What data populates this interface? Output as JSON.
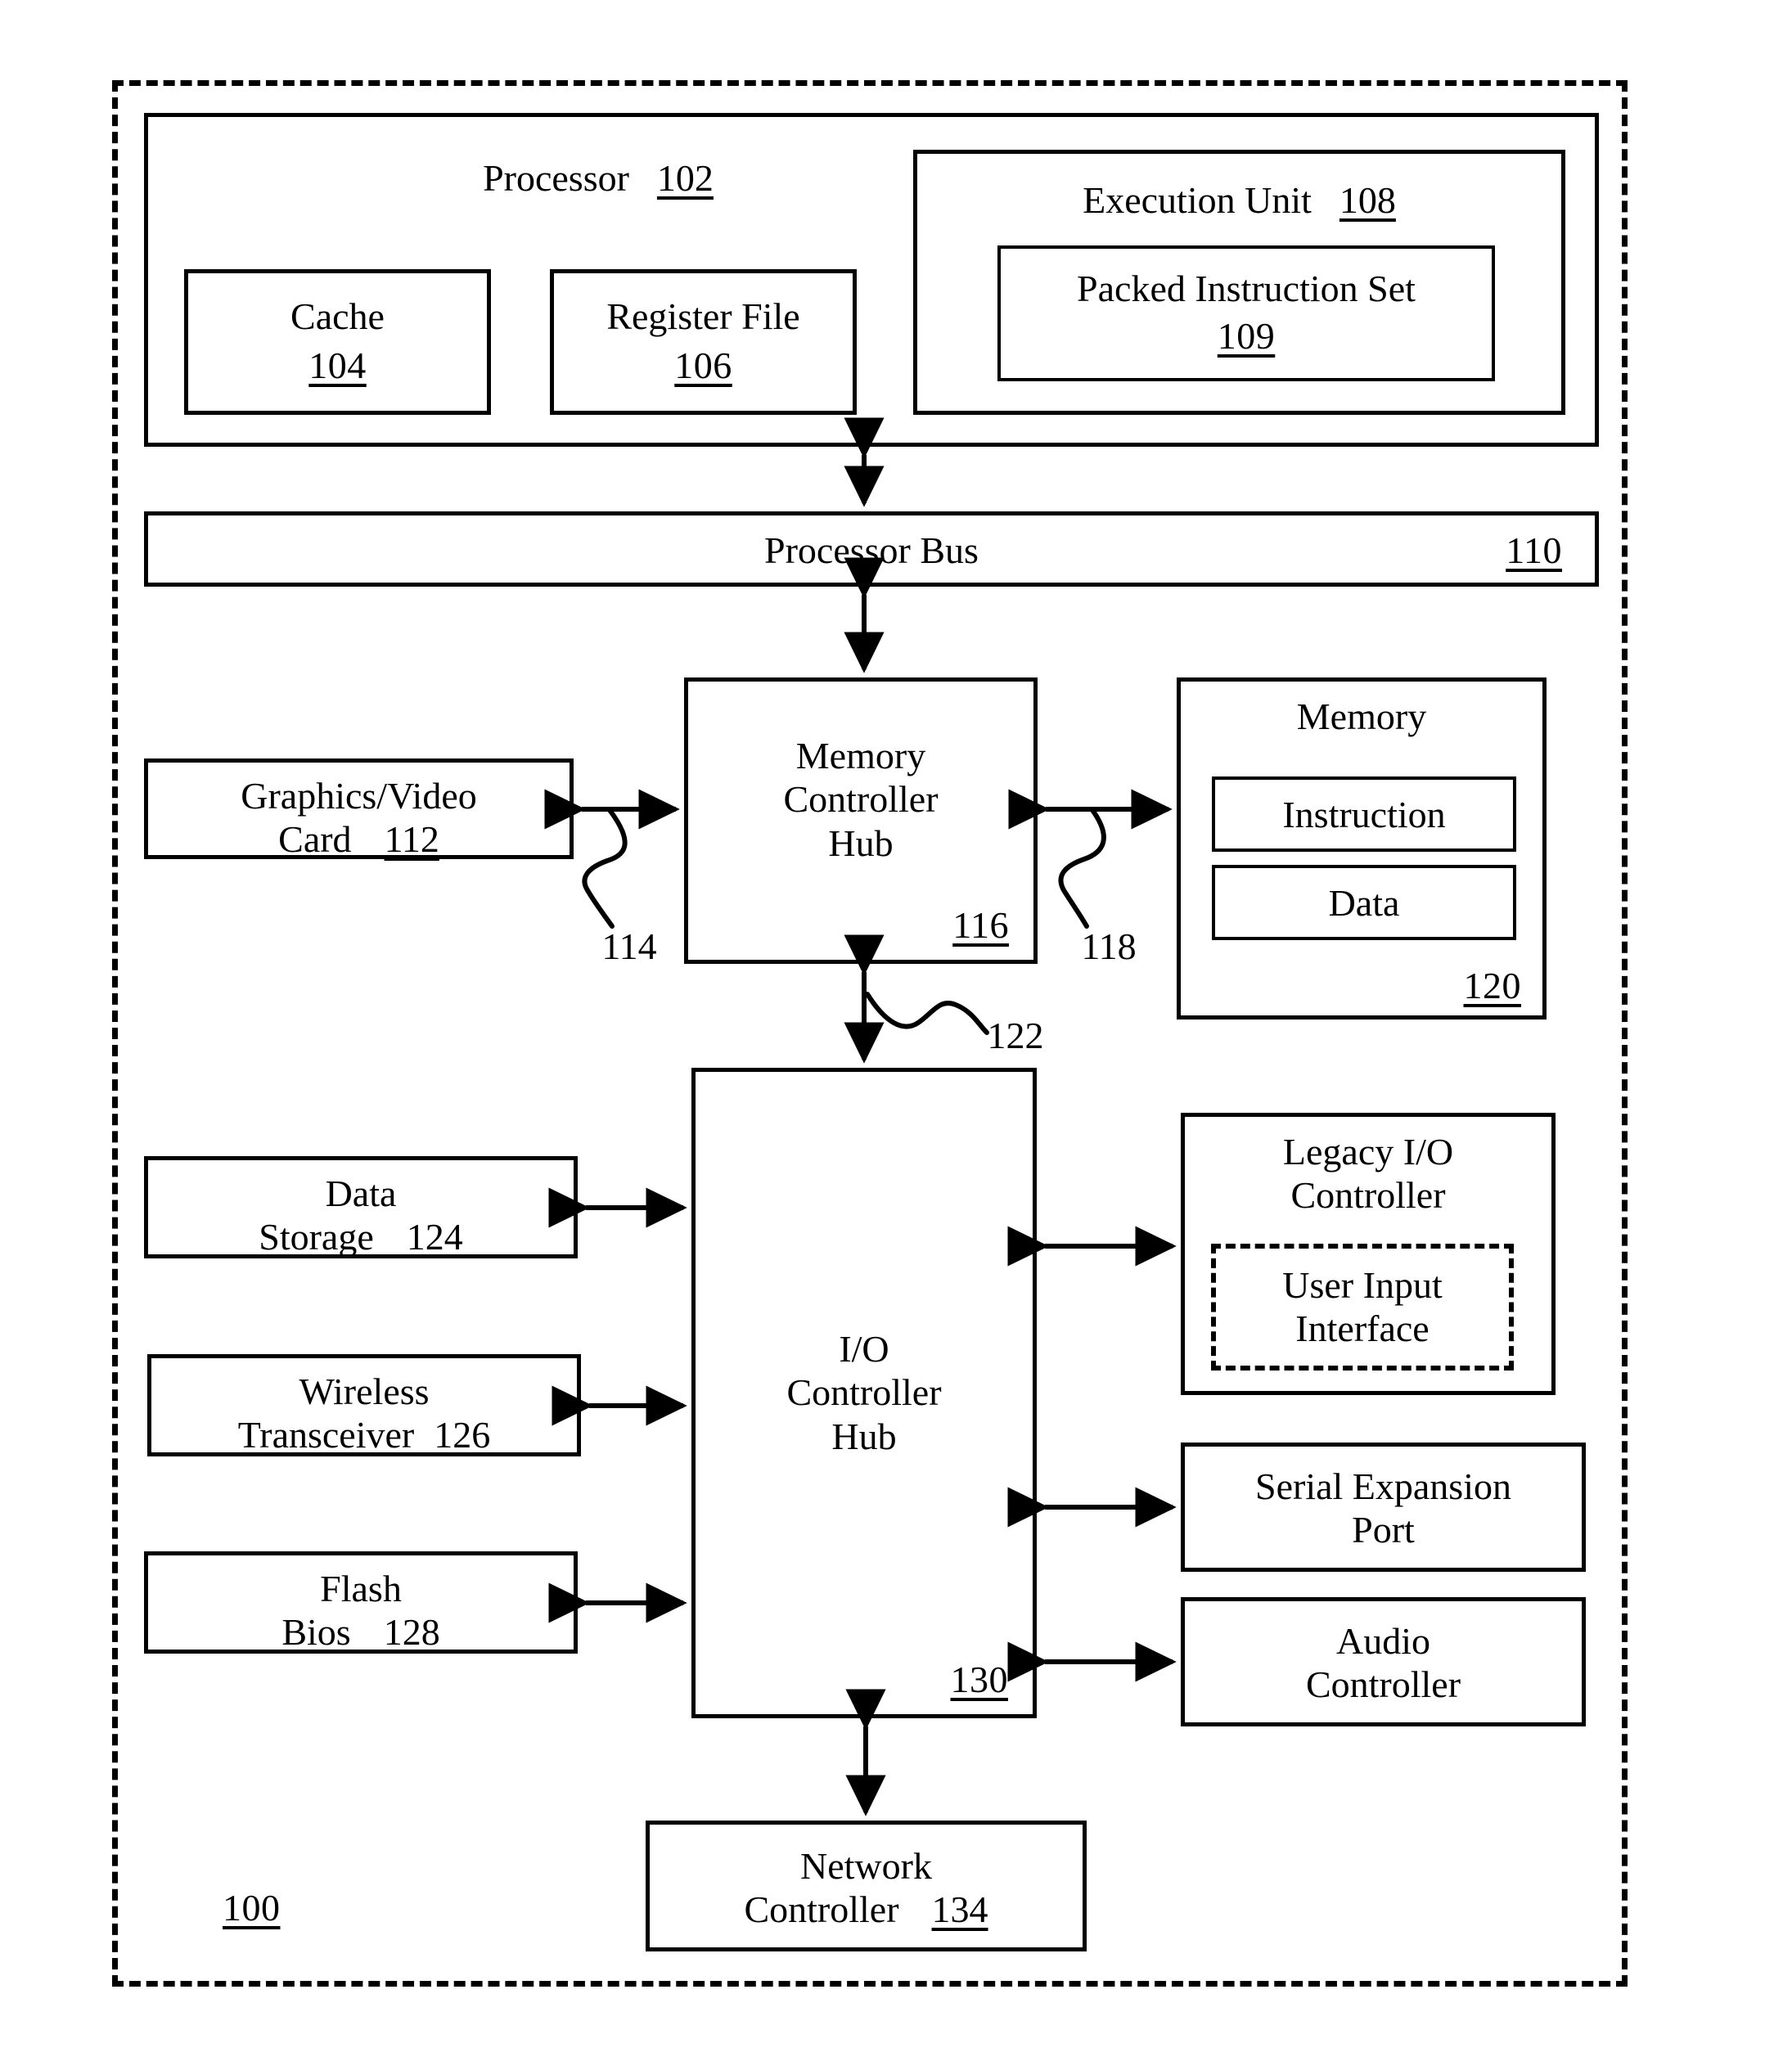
{
  "figure": {
    "system_ref": "100",
    "outer_boundary_style": "dashed"
  },
  "processor": {
    "title": "Processor",
    "ref": "102",
    "cache": {
      "label": "Cache",
      "ref": "104"
    },
    "register_file": {
      "label": "Register File",
      "ref": "106"
    },
    "execution_unit": {
      "title": "Execution Unit",
      "ref": "108",
      "packed_instruction_set": {
        "label": "Packed Instruction Set",
        "ref": "109"
      }
    }
  },
  "processor_bus": {
    "label": "Processor Bus",
    "ref": "110"
  },
  "graphics_video_card": {
    "line1": "Graphics/Video",
    "line2": "Card",
    "ref": "112"
  },
  "lead_114": "114",
  "memory_controller_hub": {
    "line1": "Memory",
    "line2": "Controller",
    "line3": "Hub",
    "ref": "116"
  },
  "lead_118": "118",
  "lead_122": "122",
  "memory": {
    "title": "Memory",
    "ref": "120",
    "instruction": "Instruction",
    "data": "Data"
  },
  "io_controller_hub": {
    "line1": "I/O",
    "line2": "Controller",
    "line3": "Hub",
    "ref": "130"
  },
  "data_storage": {
    "line1": "Data",
    "line2": "Storage",
    "ref": "124"
  },
  "wireless_transceiver": {
    "line1": "Wireless",
    "line2": "Transceiver",
    "ref": "126"
  },
  "flash_bios": {
    "line1": "Flash",
    "line2": "Bios",
    "ref": "128"
  },
  "legacy_io_controller": {
    "line1": "Legacy I/O",
    "line2": "Controller",
    "user_input_interface": {
      "line1": "User Input",
      "line2": "Interface"
    }
  },
  "serial_expansion_port": {
    "line1": "Serial Expansion",
    "line2": "Port"
  },
  "audio_controller": {
    "line1": "Audio",
    "line2": "Controller"
  },
  "network_controller": {
    "line1": "Network",
    "line2": "Controller",
    "ref": "134"
  },
  "colors": {
    "ink": "#000000",
    "paper": "#ffffff"
  }
}
